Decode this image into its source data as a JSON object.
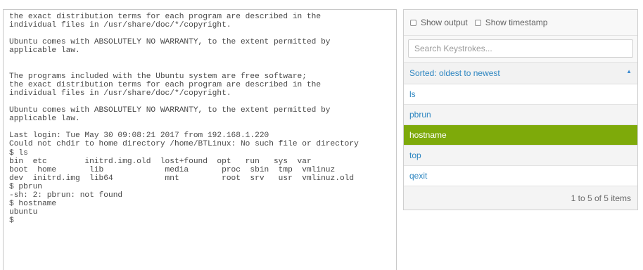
{
  "terminal": {
    "lines": [
      "the exact distribution terms for each program are described in the",
      "individual files in /usr/share/doc/*/copyright.",
      "",
      "Ubuntu comes with ABSOLUTELY NO WARRANTY, to the extent permitted by",
      "applicable law.",
      "",
      "",
      "The programs included with the Ubuntu system are free software;",
      "the exact distribution terms for each program are described in the",
      "individual files in /usr/share/doc/*/copyright.",
      "",
      "Ubuntu comes with ABSOLUTELY NO WARRANTY, to the extent permitted by",
      "applicable law.",
      "",
      "Last login: Tue May 30 09:08:21 2017 from 192.168.1.220",
      "Could not chdir to home directory /home/BTLinux: No such file or directory",
      "$ ls",
      "bin  etc        initrd.img.old  lost+found  opt   run   sys  var",
      "boot  home       lib             media       proc  sbin  tmp  vmlinuz",
      "dev  initrd.img  lib64           mnt         root  srv   usr  vmlinuz.old",
      "$ pbrun",
      "-sh: 2: pbrun: not found",
      "$ hostname",
      "ubuntu",
      "$"
    ]
  },
  "panel": {
    "show_output_label": "Show output",
    "show_timestamp_label": "Show timestamp",
    "search_placeholder": "Search Keystrokes...",
    "sort_label": "Sorted: oldest to newest",
    "sort_icon": "sort-ascending-icon",
    "items": [
      {
        "label": "ls",
        "selected": false
      },
      {
        "label": "pbrun",
        "selected": false
      },
      {
        "label": "hostname",
        "selected": true
      },
      {
        "label": "top",
        "selected": false
      },
      {
        "label": "qexit",
        "selected": false
      }
    ],
    "footer_text": "1 to 5 of 5 items"
  },
  "colors": {
    "link": "#2e86c1",
    "selected_row": "#7eaa0a",
    "terminal_text": "#4a4a4a"
  }
}
